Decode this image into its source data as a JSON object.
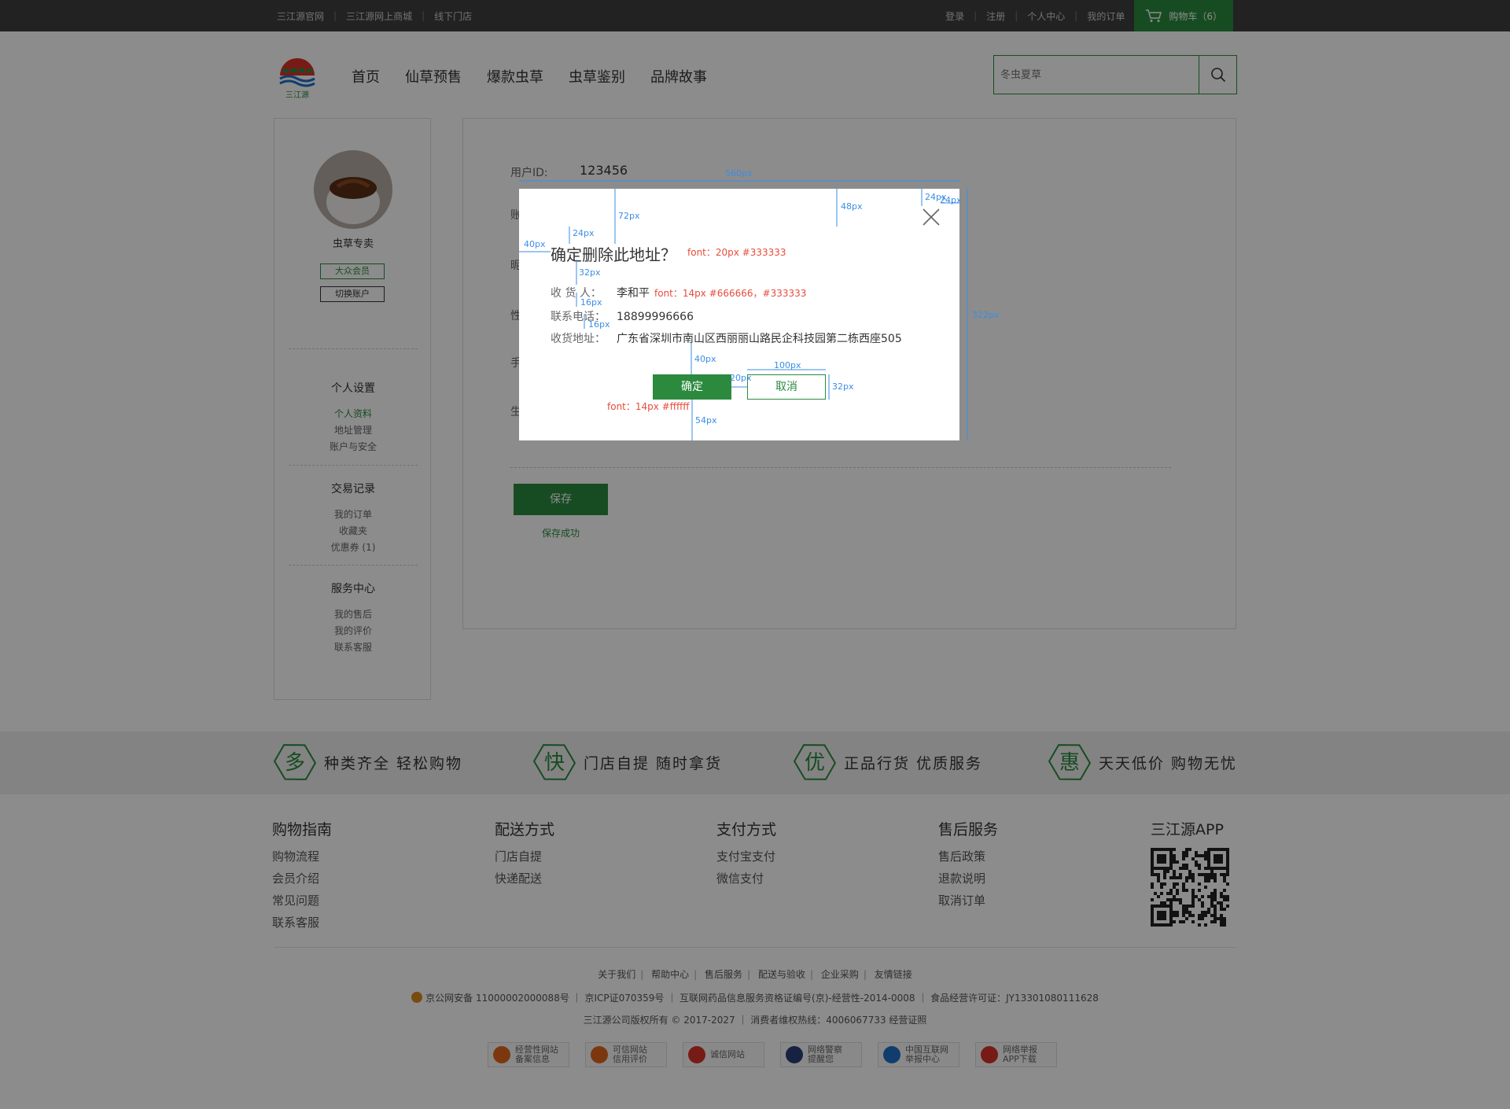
{
  "topbar": {
    "left_links": [
      "三江源官网",
      "三江源网上商城",
      "线下门店"
    ],
    "right_links": [
      "登录",
      "注册",
      "个人中心",
      "我的订单"
    ],
    "cart_label": "购物车（6）"
  },
  "logo": {
    "text": "三江源"
  },
  "nav": [
    "首页",
    "仙草预售",
    "爆款虫草",
    "虫草鉴别",
    "品牌故事"
  ],
  "search": {
    "placeholder": "冬虫夏草",
    "icon": "search-icon"
  },
  "sidebar": {
    "username": "虫草专卖",
    "member_badge": "大众会员",
    "switch_account": "切换账户",
    "sections": [
      {
        "title": "个人设置",
        "items": [
          "个人资料",
          "地址管理",
          "账户与安全"
        ]
      },
      {
        "title": "交易记录",
        "items": [
          "我的订单",
          "收藏夹",
          "优惠券 (1)"
        ]
      },
      {
        "title": "服务中心",
        "items": [
          "我的售后",
          "我的评价",
          "联系客服"
        ]
      }
    ]
  },
  "main": {
    "uid_label": "用户ID:",
    "uid_value": "123456",
    "row_labels": [
      "账",
      "昵",
      "性",
      "手",
      "生"
    ],
    "save_label": "保存",
    "save_msg": "保存成功"
  },
  "features": [
    {
      "char": "多",
      "text": "种类齐全 轻松购物"
    },
    {
      "char": "快",
      "text": "门店自提  随时拿货"
    },
    {
      "char": "优",
      "text": "正品行货  优质服务"
    },
    {
      "char": "惠",
      "text": "天天低价  购物无忧"
    }
  ],
  "footer": {
    "columns": [
      {
        "title": "购物指南",
        "items": [
          "购物流程",
          "会员介绍",
          "常见问题",
          "联系客服"
        ]
      },
      {
        "title": "配送方式",
        "items": [
          "门店自提",
          "快递配送"
        ]
      },
      {
        "title": "支付方式",
        "items": [
          "支付宝支付",
          "微信支付"
        ]
      },
      {
        "title": "售后服务",
        "items": [
          "售后政策",
          "退款说明",
          "取消订单"
        ]
      }
    ],
    "app_title": "三江源APP",
    "links": [
      "关于我们",
      "帮助中心",
      "售后服务",
      "配送与验收",
      "企业采购",
      "友情链接"
    ],
    "license": "京公网安备 11000002000088号  ｜ 京ICP证070359号 ｜ 互联网药品信息服务资格证编号(京)-经营性-2014-0008 ｜ 食品经营许可证：JY13301080111628",
    "copyright": "三江源公司版权所有 © 2017-2027  ｜  消费者维权热线：4006067733    经营证照",
    "certs": [
      {
        "line1": "经营性网站",
        "line2": "备案信息",
        "color": "#e0661d"
      },
      {
        "line1": "可信网站",
        "line2": "信用评价",
        "color": "#e0661d"
      },
      {
        "line1": "诚信网站",
        "line2": "",
        "color": "#d9322b"
      },
      {
        "line1": "网络警察",
        "line2": "提醒您",
        "color": "#2a3f7a"
      },
      {
        "line1": "中国互联网",
        "line2": "举报中心",
        "color": "#1f6fc9"
      },
      {
        "line1": "网络举报",
        "line2": "APP下载",
        "color": "#d9322b"
      }
    ]
  },
  "modal": {
    "title": "确定删除此地址？",
    "rows": [
      {
        "key": "收 货 人：",
        "value": "李和平"
      },
      {
        "key": "联系电话：",
        "value": "18899996666"
      },
      {
        "key": "收货地址：",
        "value": "广东省深圳市南山区西丽丽山路民企科技园第二栋西座505"
      }
    ],
    "confirm_label": "确定",
    "cancel_label": "取消",
    "close_icon": "close-icon"
  },
  "annotations": {
    "dims": [
      "560px",
      "72px",
      "48px",
      "24px",
      "24px",
      "40px",
      "24px",
      "32px",
      "16px",
      "16px",
      "40px",
      "20px",
      "100px",
      "32px",
      "54px",
      "322px"
    ],
    "notes": [
      "font：20px   #333333",
      "font：14px  #666666，#333333",
      "font：14px    #ffffff"
    ]
  }
}
